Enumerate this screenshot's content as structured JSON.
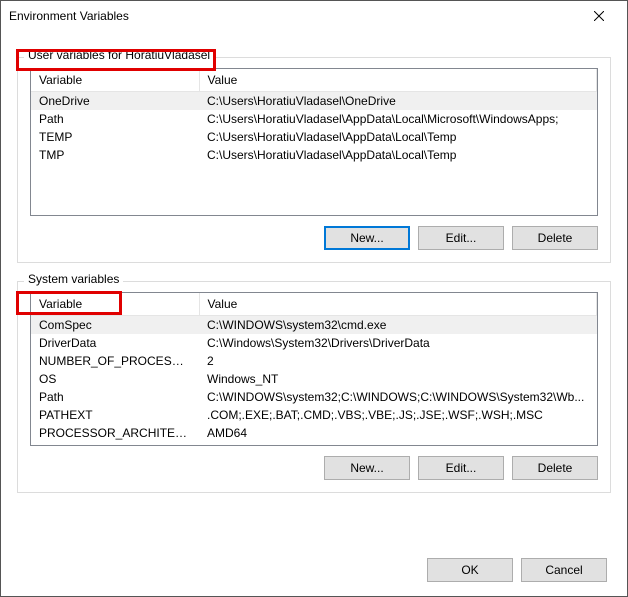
{
  "window": {
    "title": "Environment Variables"
  },
  "user_group": {
    "label": "User variables for HoratiuVladasel"
  },
  "system_group": {
    "label": "System variables"
  },
  "columns": {
    "variable": "Variable",
    "value": "Value"
  },
  "user_vars": [
    {
      "name": "OneDrive",
      "value": "C:\\Users\\HoratiuVladasel\\OneDrive"
    },
    {
      "name": "Path",
      "value": "C:\\Users\\HoratiuVladasel\\AppData\\Local\\Microsoft\\WindowsApps;"
    },
    {
      "name": "TEMP",
      "value": "C:\\Users\\HoratiuVladasel\\AppData\\Local\\Temp"
    },
    {
      "name": "TMP",
      "value": "C:\\Users\\HoratiuVladasel\\AppData\\Local\\Temp"
    }
  ],
  "system_vars": [
    {
      "name": "ComSpec",
      "value": "C:\\WINDOWS\\system32\\cmd.exe"
    },
    {
      "name": "DriverData",
      "value": "C:\\Windows\\System32\\Drivers\\DriverData"
    },
    {
      "name": "NUMBER_OF_PROCESSORS",
      "value": "2"
    },
    {
      "name": "OS",
      "value": "Windows_NT"
    },
    {
      "name": "Path",
      "value": "C:\\WINDOWS\\system32;C:\\WINDOWS;C:\\WINDOWS\\System32\\Wb..."
    },
    {
      "name": "PATHEXT",
      "value": ".COM;.EXE;.BAT;.CMD;.VBS;.VBE;.JS;.JSE;.WSF;.WSH;.MSC"
    },
    {
      "name": "PROCESSOR_ARCHITECTURE",
      "value": "AMD64"
    }
  ],
  "buttons": {
    "new": "New...",
    "edit": "Edit...",
    "delete": "Delete",
    "ok": "OK",
    "cancel": "Cancel"
  }
}
